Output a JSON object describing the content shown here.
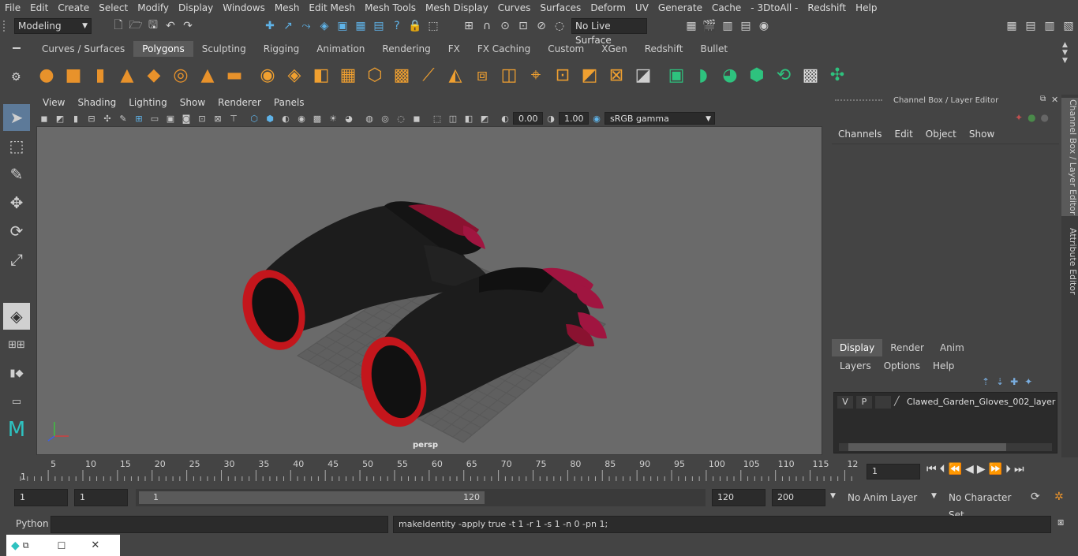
{
  "menubar": [
    "File",
    "Edit",
    "Create",
    "Select",
    "Modify",
    "Display",
    "Windows",
    "Mesh",
    "Edit Mesh",
    "Mesh Tools",
    "Mesh Display",
    "Curves",
    "Surfaces",
    "Deform",
    "UV",
    "Generate",
    "Cache",
    "- 3DtoAll -",
    "Redshift",
    "Help"
  ],
  "status": {
    "mode": "Modeling",
    "live_surface": "No Live Surface"
  },
  "shelf": {
    "tabs": [
      "Curves / Surfaces",
      "Polygons",
      "Sculpting",
      "Rigging",
      "Animation",
      "Rendering",
      "FX",
      "FX Caching",
      "Custom",
      "XGen",
      "Redshift",
      "Bullet"
    ],
    "active_tab": "Polygons"
  },
  "viewport": {
    "menu": [
      "View",
      "Shading",
      "Lighting",
      "Show",
      "Renderer",
      "Panels"
    ],
    "near_value": "0.00",
    "far_value": "1.00",
    "color_space": "sRGB gamma",
    "camera_label": "persp",
    "colors": {
      "glove": "#1a1a1a",
      "cuff": "#c4161c",
      "claw": "#a01540",
      "bg": "#6a6a6a",
      "grid": "#585858"
    }
  },
  "channel_box": {
    "title": "Channel Box / Layer Editor",
    "menu": [
      "Channels",
      "Edit",
      "Object",
      "Show"
    ]
  },
  "layer_editor": {
    "tabs": [
      "Display",
      "Render",
      "Anim"
    ],
    "active_tab": "Display",
    "menu": [
      "Layers",
      "Options",
      "Help"
    ],
    "layer": {
      "v": "V",
      "p": "P",
      "name": "Clawed_Garden_Gloves_002_layer"
    }
  },
  "side_tabs": [
    "Channel Box / Layer Editor",
    "Attribute Editor"
  ],
  "timeline": {
    "ticks": [
      "5",
      "10",
      "15",
      "20",
      "25",
      "30",
      "35",
      "40",
      "45",
      "50",
      "55",
      "60",
      "65",
      "70",
      "75",
      "80",
      "85",
      "90",
      "95",
      "100",
      "105",
      "110",
      "115",
      "12"
    ],
    "start_label": "1",
    "current_frame": "1"
  },
  "range": {
    "start": "1",
    "anim_start": "1",
    "slider_start": "1",
    "slider_end": "120",
    "end": "120",
    "anim_end": "200",
    "anim_layer": "No Anim Layer",
    "character_set": "No Character Set"
  },
  "command": {
    "lang": "Python",
    "result": "makeIdentity -apply true -t 1 -r 1 -s 1 -n 0 -pn 1;"
  }
}
